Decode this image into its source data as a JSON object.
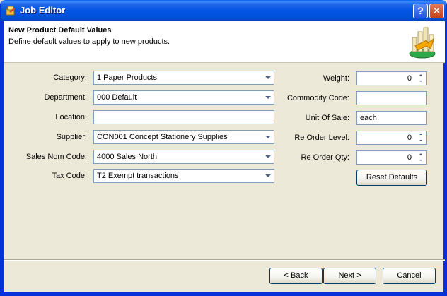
{
  "window": {
    "title": "Job Editor",
    "help_label": "?",
    "close_label": "✕"
  },
  "header": {
    "title": "New Product Default Values",
    "subtitle": "Define default values to apply to new products."
  },
  "form_left": {
    "category": {
      "label": "Category:",
      "value": "1 Paper Products"
    },
    "department": {
      "label": "Department:",
      "value": "000 Default"
    },
    "location": {
      "label": "Location:",
      "value": ""
    },
    "supplier": {
      "label": "Supplier:",
      "value": "CON001 Concept Stationery Supplies"
    },
    "sales_nom_code": {
      "label": "Sales Nom Code:",
      "value": "4000 Sales North"
    },
    "tax_code": {
      "label": "Tax Code:",
      "value": "T2 Exempt transactions"
    }
  },
  "form_right": {
    "weight": {
      "label": "Weight:",
      "value": "0"
    },
    "commodity_code": {
      "label": "Commodity Code:",
      "value": ""
    },
    "unit_of_sale": {
      "label": "Unit Of Sale:",
      "value": "each"
    },
    "reorder_level": {
      "label": "Re Order Level:",
      "value": "0"
    },
    "reorder_qty": {
      "label": "Re Order Qty:",
      "value": "0"
    },
    "reset_label": "Reset Defaults"
  },
  "footer": {
    "back_label": "< Back",
    "next_label": "Next >",
    "cancel_label": "Cancel"
  },
  "colors": {
    "titlebar": "#0255e4",
    "frame": "#0831d9",
    "face": "#ece9d8",
    "input_border": "#7f9db9"
  }
}
